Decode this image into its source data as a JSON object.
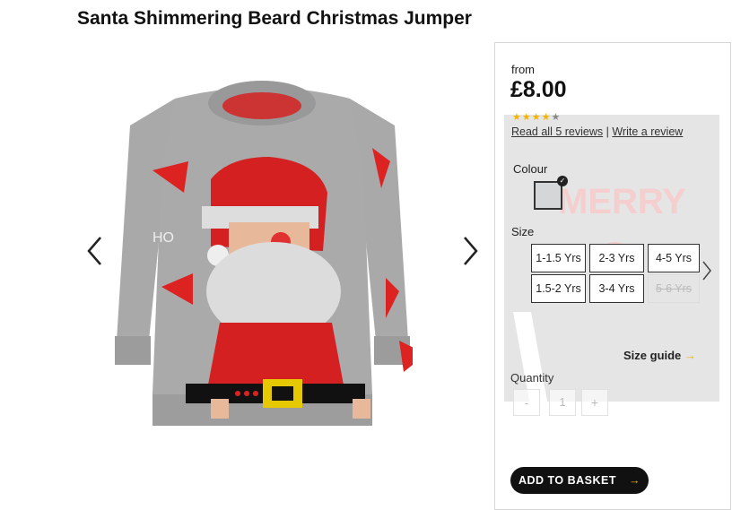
{
  "product": {
    "title": "Santa Shimmering Beard Christmas Jumper"
  },
  "gallery": {
    "prev_icon": "chevron-left-icon",
    "next_icon": "chevron-right-icon"
  },
  "pricing": {
    "from_label": "from",
    "price": "£8.00",
    "stars": "★★★★",
    "star_half": "★",
    "rating": 4.5,
    "read_reviews": "Read all 5 reviews",
    "separator": "|",
    "write_review": "Write a review"
  },
  "colour": {
    "label": "Colour",
    "selected_color": "#d4d6d8",
    "check_glyph": "✓"
  },
  "size": {
    "label": "Size",
    "options": [
      "1-1.5 Yrs",
      "2-3 Yrs",
      "4-5 Yrs",
      "1.5-2 Yrs",
      "3-4 Yrs",
      "5-6 Yrs"
    ],
    "next_icon": "chevron-right-icon",
    "guide_label": "Size guide",
    "guide_chevron": "→"
  },
  "quantity": {
    "label": "Quantity",
    "minus": "-",
    "value": "1",
    "plus": "+"
  },
  "basket": {
    "label": "ADD TO BASKET",
    "chevron": "→"
  },
  "colors": {
    "accent": "#f2b400",
    "button_bg": "#111111"
  }
}
